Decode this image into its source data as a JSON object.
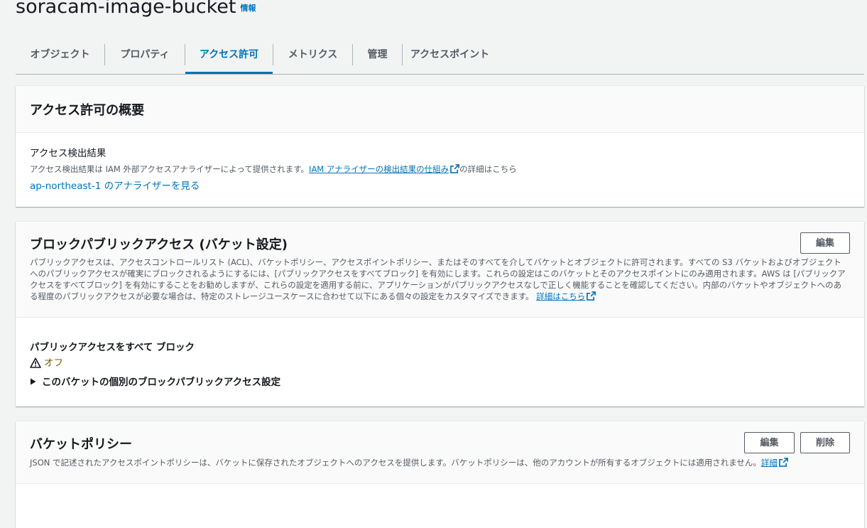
{
  "header": {
    "title": "soracam-image-bucket",
    "info": "情報"
  },
  "tabs": [
    {
      "label": "オブジェクト"
    },
    {
      "label": "プロパティ"
    },
    {
      "label": "アクセス許可"
    },
    {
      "label": "メトリクス"
    },
    {
      "label": "管理"
    },
    {
      "label": "アクセスポイント"
    }
  ],
  "active_tab": "アクセス許可",
  "overview": {
    "title": "アクセス許可の概要",
    "findings_heading": "アクセス検出結果",
    "findings_desc_prefix": "アクセス検出結果は IAM 外部アクセスアナライザーによって提供されます。",
    "findings_link": "IAM アナライザーの検出結果の仕組み",
    "findings_desc_suffix": "の詳細はこちら",
    "analyzer_link": "ap-northeast-1 のアナライザーを見る"
  },
  "block_public": {
    "title": "ブロックパブリックアクセス (バケット設定)",
    "edit_label": "編集",
    "description": "パブリックアクセスは、アクセスコントロールリスト (ACL)、バケットポリシー、アクセスポイントポリシー、またはそのすべてを介してバケットとオブジェクトに許可されます。すべての S3 バケットおよびオブジェクトへのパブリックアクセスが確実にブロックされるようにするには、[パブリックアクセスをすべてブロック] を有効にします。これらの設定はこのバケットとそのアクセスポイントにのみ適用されます。AWS は [パブリックアクセスをすべてブロック] を有効にすることをお勧めしますが、これらの設定を適用する前に、アプリケーションがパブリックアクセスなしで正しく機能することを確認してください。内部のバケットやオブジェクトへのある程度のパブリックアクセスが必要な場合は、特定のストレージユースケースに合わせて以下にある個々の設定をカスタマイズできます。",
    "details_link": "詳細はこちら",
    "setting_label": "パブリックアクセスをすべて ブロック",
    "setting_status": "オフ",
    "warning_color": "#7d5b00",
    "expand_label": "このバケットの個別のブロックパブリックアクセス設定"
  },
  "bucket_policy": {
    "title": "バケットポリシー",
    "edit_label": "編集",
    "delete_label": "削除",
    "description": "JSON で記述されたアクセスポイントポリシーは、バケットに保存されたオブジェクトへのアクセスを提供します。バケットポリシーは、他のアカウントが所有するオブジェクトには適用されません。",
    "details_link": "詳細"
  },
  "colors": {
    "link": "#0073bb",
    "background": "#f2f3f3",
    "text": "#16191f",
    "muted": "#545b64"
  }
}
